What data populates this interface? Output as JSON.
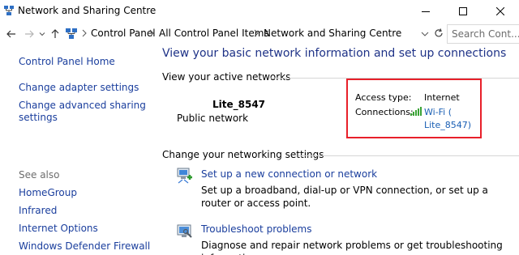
{
  "window": {
    "title": "Network and Sharing Centre"
  },
  "address_bar": {
    "crumbs": [
      "Control Panel",
      "All Control Panel Items",
      "Network and Sharing Centre"
    ],
    "search_placeholder": "Search Cont..."
  },
  "left_pane": {
    "links": [
      "Control Panel Home",
      "Change adapter settings",
      "Change advanced sharing settings"
    ],
    "see_also_label": "See also",
    "see_also_links": [
      "HomeGroup",
      "Infrared",
      "Internet Options",
      "Windows Defender Firewall"
    ]
  },
  "main": {
    "title": "View your basic network information and set up connections",
    "active_networks_heading": "View your active networks",
    "network": {
      "name": "Lite_8547",
      "type": "Public network",
      "access_type_label": "Access type:",
      "access_type_value": "Internet",
      "connections_label": "Connections:",
      "connection_line1": "Wi-Fi (",
      "connection_line2": "Lite_8547)"
    },
    "change_settings_heading": "Change your networking settings",
    "tasks": [
      {
        "icon": "new-connection-icon",
        "link": "Set up a new connection or network",
        "desc": "Set up a broadband, dial-up or VPN connection, or set up a router or access point."
      },
      {
        "icon": "troubleshoot-icon",
        "link": "Troubleshoot problems",
        "desc": "Diagnose and repair network problems or get troubleshooting information."
      }
    ]
  },
  "colors": {
    "link": "#1a3e9d",
    "title": "#1e3287",
    "highlight": "#e8202a"
  }
}
